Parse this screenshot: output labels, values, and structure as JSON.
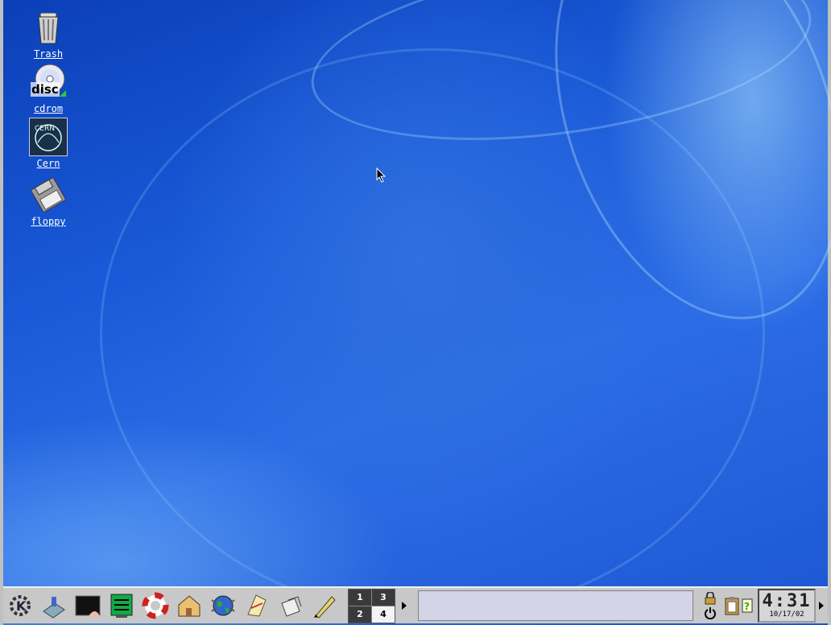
{
  "desktop": {
    "icons": [
      {
        "label": "Trash",
        "icon": "trash-icon"
      },
      {
        "label": "cdrom",
        "icon": "cdrom-icon",
        "badge": "disc"
      },
      {
        "label": "Cern",
        "icon": "cern-icon",
        "badge": "CERN"
      },
      {
        "label": "floppy",
        "icon": "floppy-icon"
      }
    ]
  },
  "panel": {
    "launchers": [
      "kde-menu-icon",
      "window-list-icon",
      "terminal-icon",
      "system-monitor-icon",
      "help-lifebuoy-icon",
      "home-folder-icon",
      "web-browser-icon",
      "mail-icon",
      "documents-icon",
      "text-editor-icon"
    ],
    "pager": {
      "desktops": [
        "1",
        "3",
        "2",
        "4"
      ],
      "active": "4"
    },
    "tray": [
      "lock-icon",
      "logout-icon",
      "klipper-icon",
      "help-icon"
    ],
    "clock": {
      "time": "4:31",
      "date": "10/17/02"
    }
  },
  "colors": {
    "desktop_bg": "#1a5ad8",
    "panel_bg": "#c8c8c8"
  }
}
